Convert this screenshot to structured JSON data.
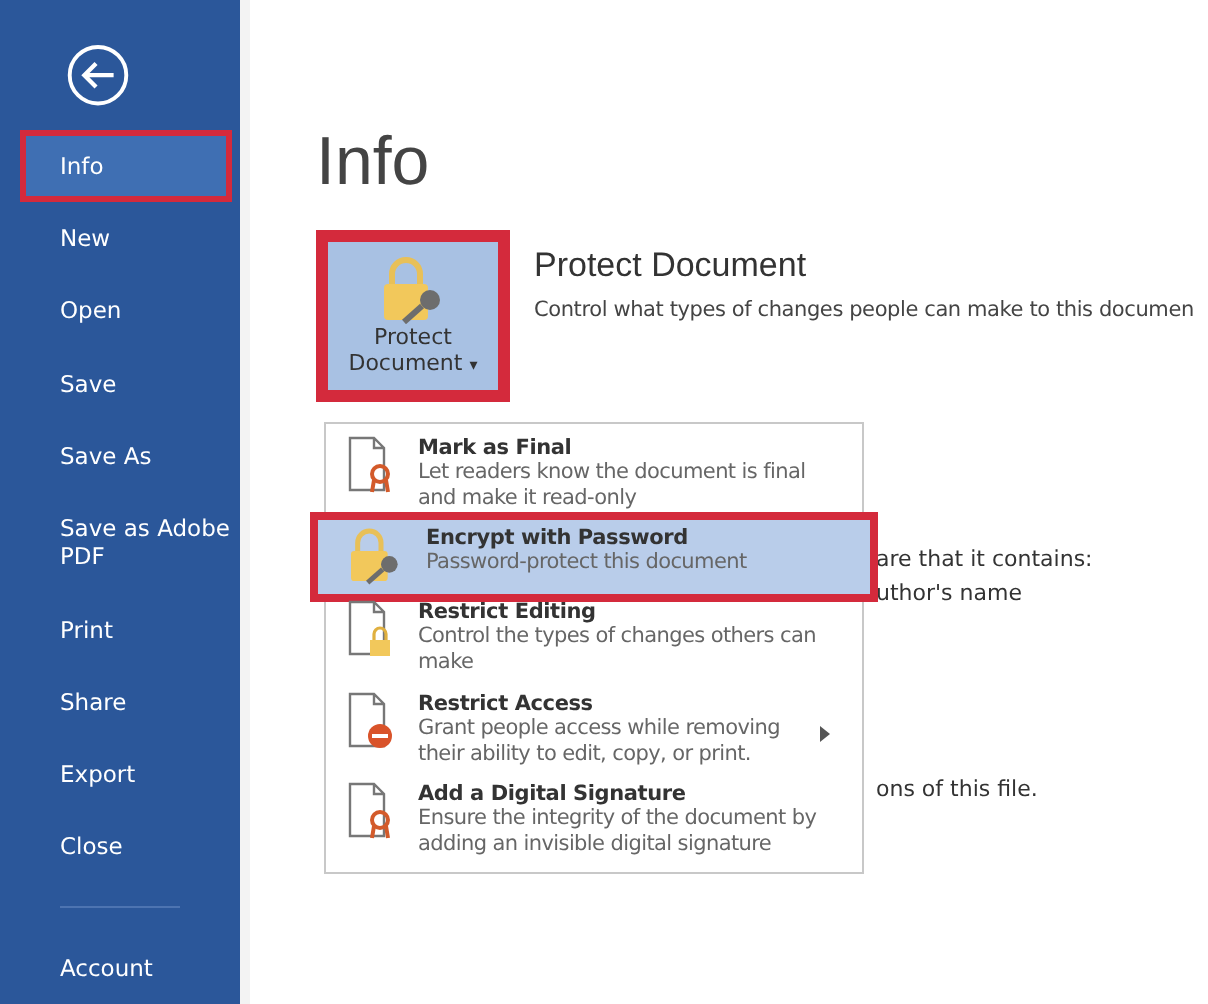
{
  "sidebar": {
    "items": [
      {
        "label": "Info",
        "selected": true,
        "annotated": true
      },
      {
        "label": "New",
        "selected": false,
        "annotated": false
      },
      {
        "label": "Open",
        "selected": false,
        "annotated": false
      },
      {
        "label": "Save",
        "selected": false,
        "annotated": false
      },
      {
        "label": "Save As",
        "selected": false,
        "annotated": false
      },
      {
        "label": "Save as Adobe PDF",
        "selected": false,
        "annotated": false
      },
      {
        "label": "Print",
        "selected": false,
        "annotated": false
      },
      {
        "label": "Share",
        "selected": false,
        "annotated": false
      },
      {
        "label": "Export",
        "selected": false,
        "annotated": false
      },
      {
        "label": "Close",
        "selected": false,
        "annotated": false
      }
    ],
    "footer_items": [
      {
        "label": "Account",
        "selected": false
      }
    ]
  },
  "page": {
    "title": "Info",
    "protect": {
      "button_label": "Protect Document",
      "caret": "▾",
      "annotated": true,
      "heading": "Protect Document",
      "description": "Control what types of changes people can make to this documen"
    },
    "hidden_texts": [
      "are that it contains:",
      "uthor's name",
      "ons of this file."
    ]
  },
  "menu": {
    "items": [
      {
        "kind": "final",
        "title": "Mark as Final",
        "description": "Let readers know the document is final and make it read-only",
        "selected": false,
        "annotated": false,
        "submenu": false
      },
      {
        "kind": "encrypt",
        "title": "Encrypt with Password",
        "description": "Password-protect this document",
        "selected": true,
        "annotated": true,
        "submenu": false
      },
      {
        "kind": "edit",
        "title": "Restrict Editing",
        "description": "Control the types of changes others can make",
        "selected": false,
        "annotated": false,
        "submenu": false
      },
      {
        "kind": "access",
        "title": "Restrict Access",
        "description": "Grant people access while removing their ability to edit, copy, or print.",
        "selected": false,
        "annotated": false,
        "submenu": true
      },
      {
        "kind": "signature",
        "title": "Add a Digital Signature",
        "description": "Ensure the integrity of the document by adding an invisible digital signature",
        "selected": false,
        "annotated": false,
        "submenu": false
      }
    ]
  }
}
